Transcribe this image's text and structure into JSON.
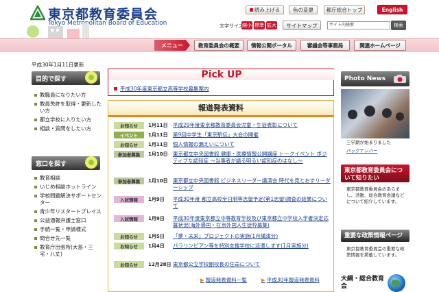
{
  "header": {
    "site_title_jp": "東京都教育委員会",
    "site_title_en": "Tokyo Metropolitan Board of Education",
    "read_aloud": "読み上げる",
    "color_change": "色の変更",
    "top_link": "都庁総合トップ",
    "english": "English",
    "font_size_label": "文字サイズ",
    "font_small": "縮小",
    "font_std": "標準",
    "font_large": "拡大",
    "sitemap": "サイトマップ",
    "search_placeholder": "サイト内検索",
    "search_button": "検索"
  },
  "nav": {
    "menu": "メニュー",
    "items": [
      "教育委員会の概要",
      "情報公開ポータル",
      "審議会等事務局",
      "関連ホームページ"
    ]
  },
  "updated": "平成30年1月11日更新",
  "left": {
    "purpose_title": "目的で探す",
    "purpose_items": [
      "教職員になりたい方",
      "教員免許を取得・更新したい方",
      "都立学校に入りたい方",
      "相談・質問をしたい方"
    ],
    "window_title": "窓口を探す",
    "window_items": [
      "教育相談",
      "いじめ相談ホットライン",
      "学校問題解決サポートセンター",
      "青少年リスタートプレイス",
      "公益通報弁護士窓口",
      "手続一覧・申請様式",
      "問合せ先一覧",
      "教育庁出張所(大島・三宅・八丈)"
    ]
  },
  "pickup": {
    "title": "Pick UP",
    "link": "平成30年度東京都立高等学校募集案内"
  },
  "press": {
    "title": "報道発表資料",
    "rows": [
      {
        "tag": "お知らせ",
        "kind": "news",
        "date": "1月11日",
        "text": "平成29年度東京都教育委員会児童・生徒表彰について"
      },
      {
        "tag": "イベント",
        "kind": "event",
        "date": "1月11日",
        "text": "第9回中学生「東京駅伝」大会の開催"
      },
      {
        "tag": "お知らせ",
        "kind": "news",
        "date": "1月11日",
        "text": "個人情報の漏えいについて"
      },
      {
        "tag": "参加者募集",
        "kind": "join",
        "date": "1月10日",
        "text": "東京都立中央図書館 健康・医療情報公開講座 トークイベント ポジティブな認知症 ～当事者が語る明るい認知症のはなし～"
      },
      {
        "tag": "参加者募集",
        "kind": "join",
        "date": "1月10日",
        "text": "東京都立中央図書館 ビジネスリーダー講演会 時代を見とおすリーダーシップ"
      },
      {
        "tag": "入試情報",
        "kind": "exam",
        "date": "1月9日",
        "text": "平成30年度 都立高校全日制等志望予定(第1志望)調査の結果について"
      },
      {
        "tag": "入試情報",
        "kind": "exam",
        "date": "1月9日",
        "text": "平成30年度東京都立中等教育学校及び東京都立中学校入学者決定応募状況(海外帰国・在京外国人生徒枠募集)"
      },
      {
        "tag": "お知らせ",
        "kind": "news",
        "date": "1月5日",
        "text": "「夢・未来」プロジェクトの実施(1月講演分)"
      },
      {
        "tag": "お知らせ",
        "kind": "news",
        "date": "1月4日",
        "text": "パラリンピアン等を特別支援学校に派遣します(1月実施分)"
      },
      {
        "tag": "お知らせ",
        "kind": "news",
        "date": "12月28日",
        "text": "東京都公立学校副校長の任命について"
      }
    ],
    "more_list": "報道発表資料一覧",
    "more_year": "平成30年報道発表資料"
  },
  "right": {
    "photo_title": "Photo News",
    "photo_caption": "三学期が始まりました",
    "backnumber": "バックナンバー",
    "board_title": "東京都教育委員会について知りたい",
    "board_text": "東京都教育委員会のあらまし、活動、総合教育会議などについて紹介しています。",
    "policy_title": "重要な政策情報ページ",
    "policy_text": "東京都教育委員会の重要な政策情報を掲載しています。",
    "outline_title": "大綱・総合教育会"
  }
}
